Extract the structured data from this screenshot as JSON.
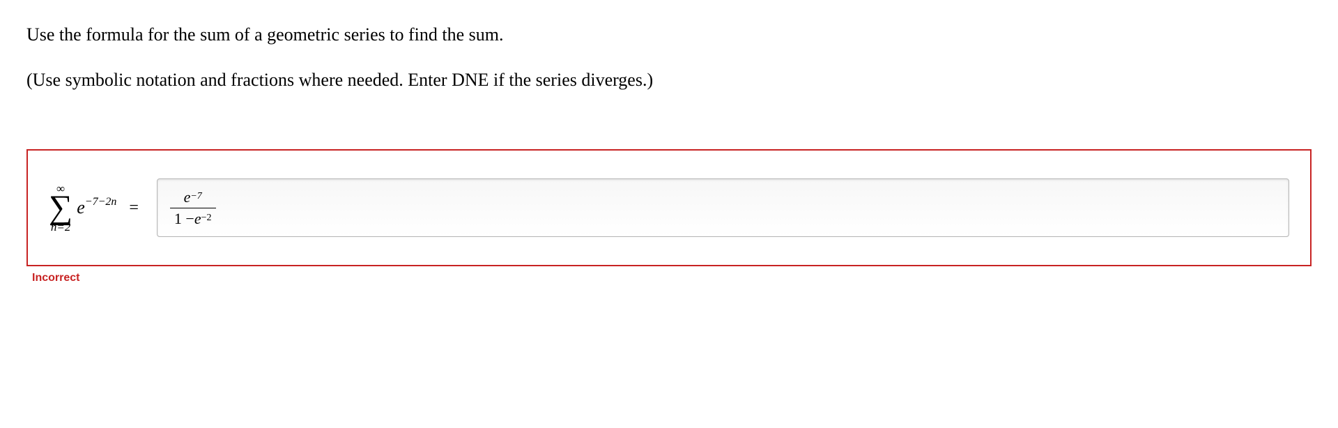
{
  "question": {
    "line1": "Use the formula for the sum of a geometric series to find the sum.",
    "line2": "(Use symbolic notation and fractions where needed. Enter DNE if the series diverges.)"
  },
  "equation": {
    "sigma_upper": "∞",
    "sigma_lower": "n=2",
    "summand_base": "e",
    "summand_exponent": "−7−2n",
    "equals": "="
  },
  "answer": {
    "numerator_base": "e",
    "numerator_exp": "−7",
    "denominator_prefix": "1 − ",
    "denominator_base": "e",
    "denominator_exp": "−2"
  },
  "status": "Incorrect"
}
